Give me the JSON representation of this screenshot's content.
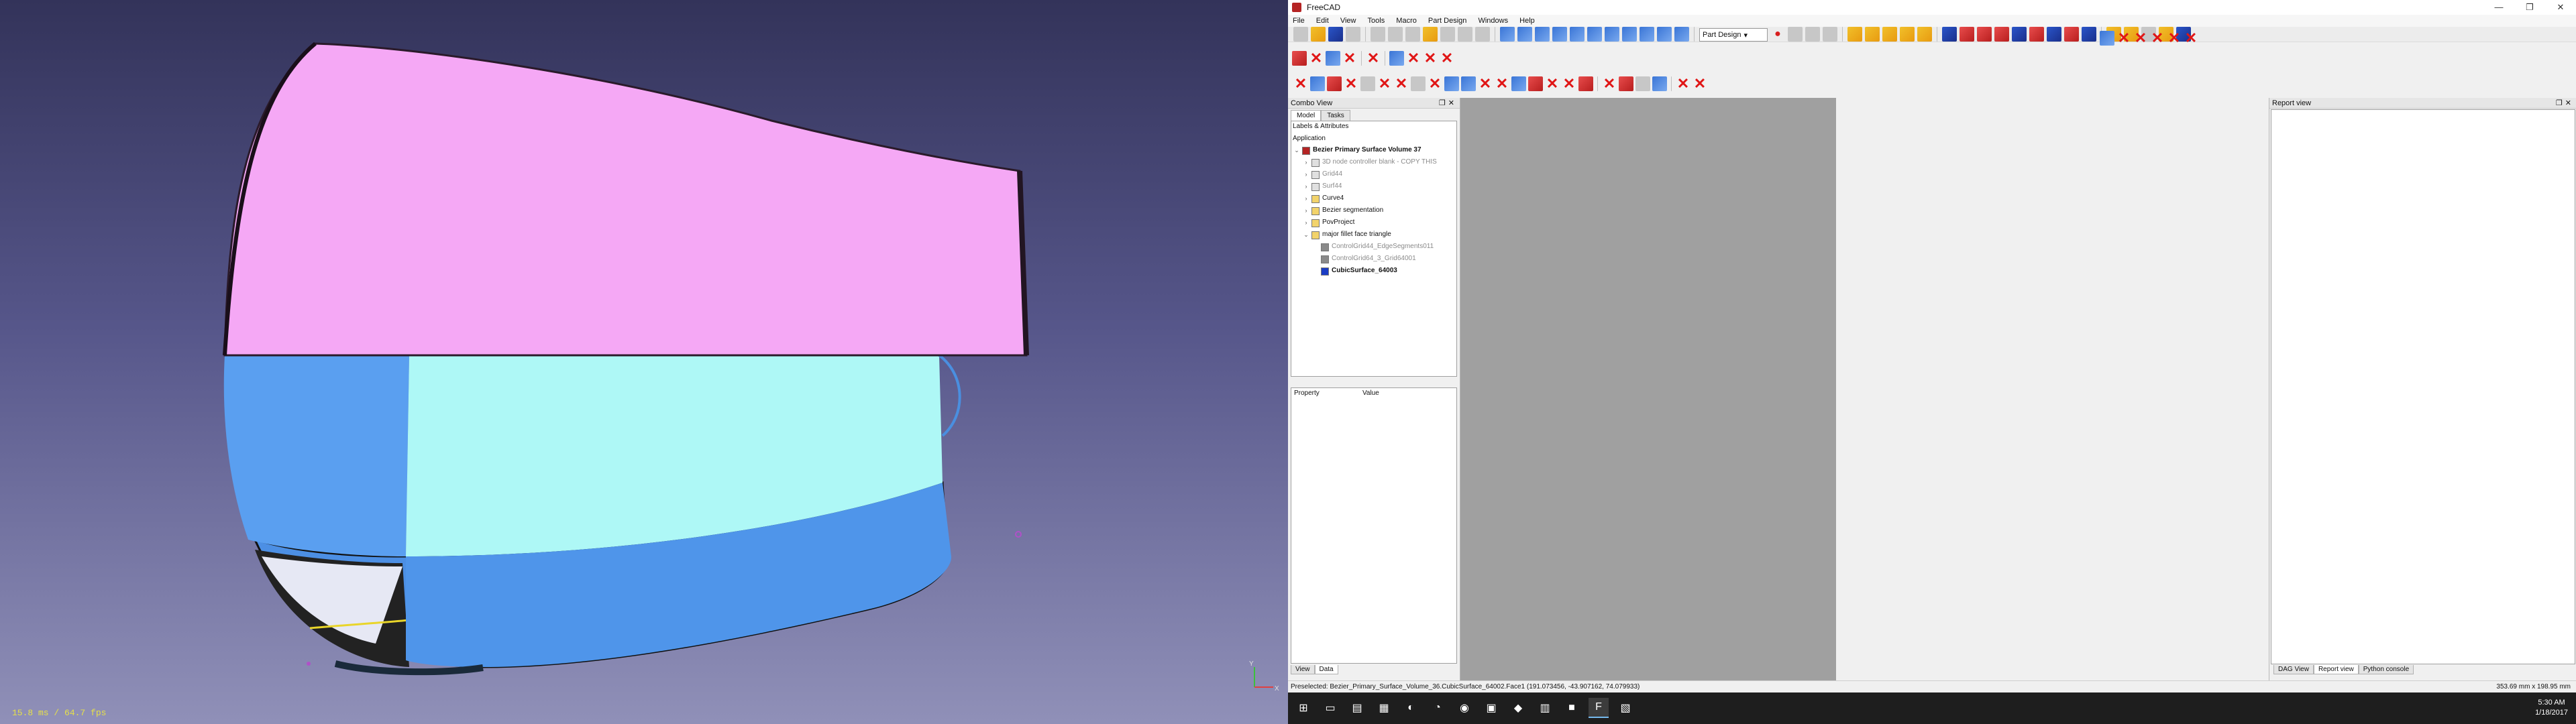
{
  "viewport": {
    "fps_label": "15.8 ms / 64.7 fps",
    "axis_x": "X",
    "axis_y": "Y"
  },
  "window": {
    "title": "FreeCAD",
    "controls": [
      "—",
      "❐",
      "✕"
    ]
  },
  "menu": [
    "File",
    "Edit",
    "View",
    "Tools",
    "Macro",
    "Part Design",
    "Windows",
    "Help"
  ],
  "toolbar": {
    "workbench": "Part Design"
  },
  "combo_view": {
    "title": "Combo View",
    "tabs": [
      "Model",
      "Tasks"
    ],
    "section_labels": "Labels & Attributes",
    "section_app": "Application",
    "tree": [
      {
        "label": "Bezier Primary Surface Volume 37",
        "level": 0,
        "style": "bold",
        "expander": "⌄",
        "icon": "doc"
      },
      {
        "label": "3D node controller blank - COPY THIS",
        "level": 1,
        "style": "dim",
        "expander": "›",
        "icon": "part"
      },
      {
        "label": "Grid44",
        "level": 1,
        "style": "dim",
        "expander": "›",
        "icon": "part"
      },
      {
        "label": "Surf44",
        "level": 1,
        "style": "dim",
        "expander": "›",
        "icon": "part"
      },
      {
        "label": "Curve4",
        "level": 1,
        "style": "normal",
        "expander": "›",
        "icon": "folder"
      },
      {
        "label": "Bezier segmentation",
        "level": 1,
        "style": "normal",
        "expander": "›",
        "icon": "folder"
      },
      {
        "label": "PovProject",
        "level": 1,
        "style": "normal",
        "expander": "›",
        "icon": "folder"
      },
      {
        "label": "major fillet face triangle",
        "level": 1,
        "style": "normal",
        "expander": "⌄",
        "icon": "folder"
      },
      {
        "label": "ControlGrid44_EdgeSegments011",
        "level": 2,
        "style": "dim",
        "expander": "",
        "icon": "grid"
      },
      {
        "label": "ControlGrid64_3_Grid64001",
        "level": 2,
        "style": "dim",
        "expander": "",
        "icon": "grid"
      },
      {
        "label": "CubicSurface_64003",
        "level": 2,
        "style": "bold",
        "expander": "",
        "icon": "surface"
      }
    ],
    "property_header": "Property",
    "value_header": "Value",
    "bottom_tabs": [
      "View",
      "Data"
    ]
  },
  "report_view": {
    "title": "Report view",
    "tabs": [
      "DAG View",
      "Report view",
      "Python console"
    ]
  },
  "status": {
    "preselected": "Preselected: Bezier_Primary_Surface_Volume_36.CubicSurface_64002.Face1 (191.073456, -43.907162, 74.079933)",
    "dimensions": "353.69 mm x 198.95 mm"
  },
  "clock": {
    "time": "5:30 AM",
    "date": "1/18/2017"
  },
  "colors": {
    "pink": "#f5a6f5",
    "cyan": "#aafaf8",
    "blue": "#5b9ff0",
    "viewport_top": "#33335a",
    "viewport_bottom": "#9090b8"
  }
}
